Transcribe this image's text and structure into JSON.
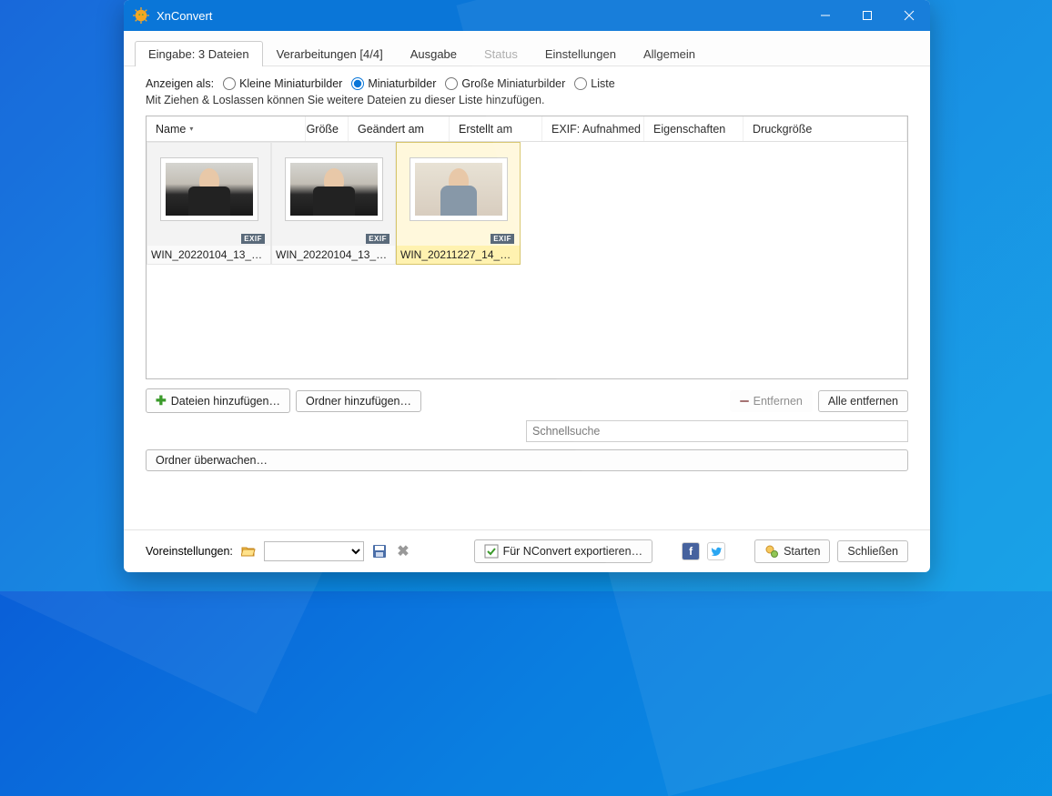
{
  "window": {
    "title": "XnConvert"
  },
  "tabs": [
    {
      "label": "Eingabe: 3 Dateien",
      "active": true
    },
    {
      "label": "Verarbeitungen [4/4]"
    },
    {
      "label": "Ausgabe"
    },
    {
      "label": "Status",
      "disabled": true
    },
    {
      "label": "Einstellungen"
    },
    {
      "label": "Allgemein"
    }
  ],
  "viewAs": {
    "label": "Anzeigen als:",
    "options": {
      "small": "Kleine Miniaturbilder",
      "medium": "Miniaturbilder",
      "large": "Große Miniaturbilder",
      "list": "Liste"
    },
    "selected": "medium"
  },
  "hint": "Mit Ziehen & Loslassen können Sie weitere Dateien zu dieser Liste hinzufügen.",
  "columns": {
    "name": "Name",
    "size": "Größe",
    "modified": "Geändert am",
    "created": "Erstellt am",
    "exif": "EXIF: Aufnahmed",
    "props": "Eigenschaften",
    "print": "Druckgröße"
  },
  "files": [
    {
      "name": "WIN_20220104_13_1…",
      "badge": "EXIF"
    },
    {
      "name": "WIN_20220104_13_1…",
      "badge": "EXIF"
    },
    {
      "name": "WIN_20211227_14_3…",
      "badge": "EXIF",
      "selected": true,
      "light": true
    }
  ],
  "buttons": {
    "addFiles": "Dateien hinzufügen…",
    "addFolder": "Ordner hinzufügen…",
    "remove": "Entfernen",
    "removeAll": "Alle entfernen",
    "watch": "Ordner überwachen…",
    "export": "Für NConvert exportieren…",
    "start": "Starten",
    "close": "Schließen"
  },
  "search": {
    "placeholder": "Schnellsuche"
  },
  "footer": {
    "presetsLabel": "Voreinstellungen:"
  }
}
